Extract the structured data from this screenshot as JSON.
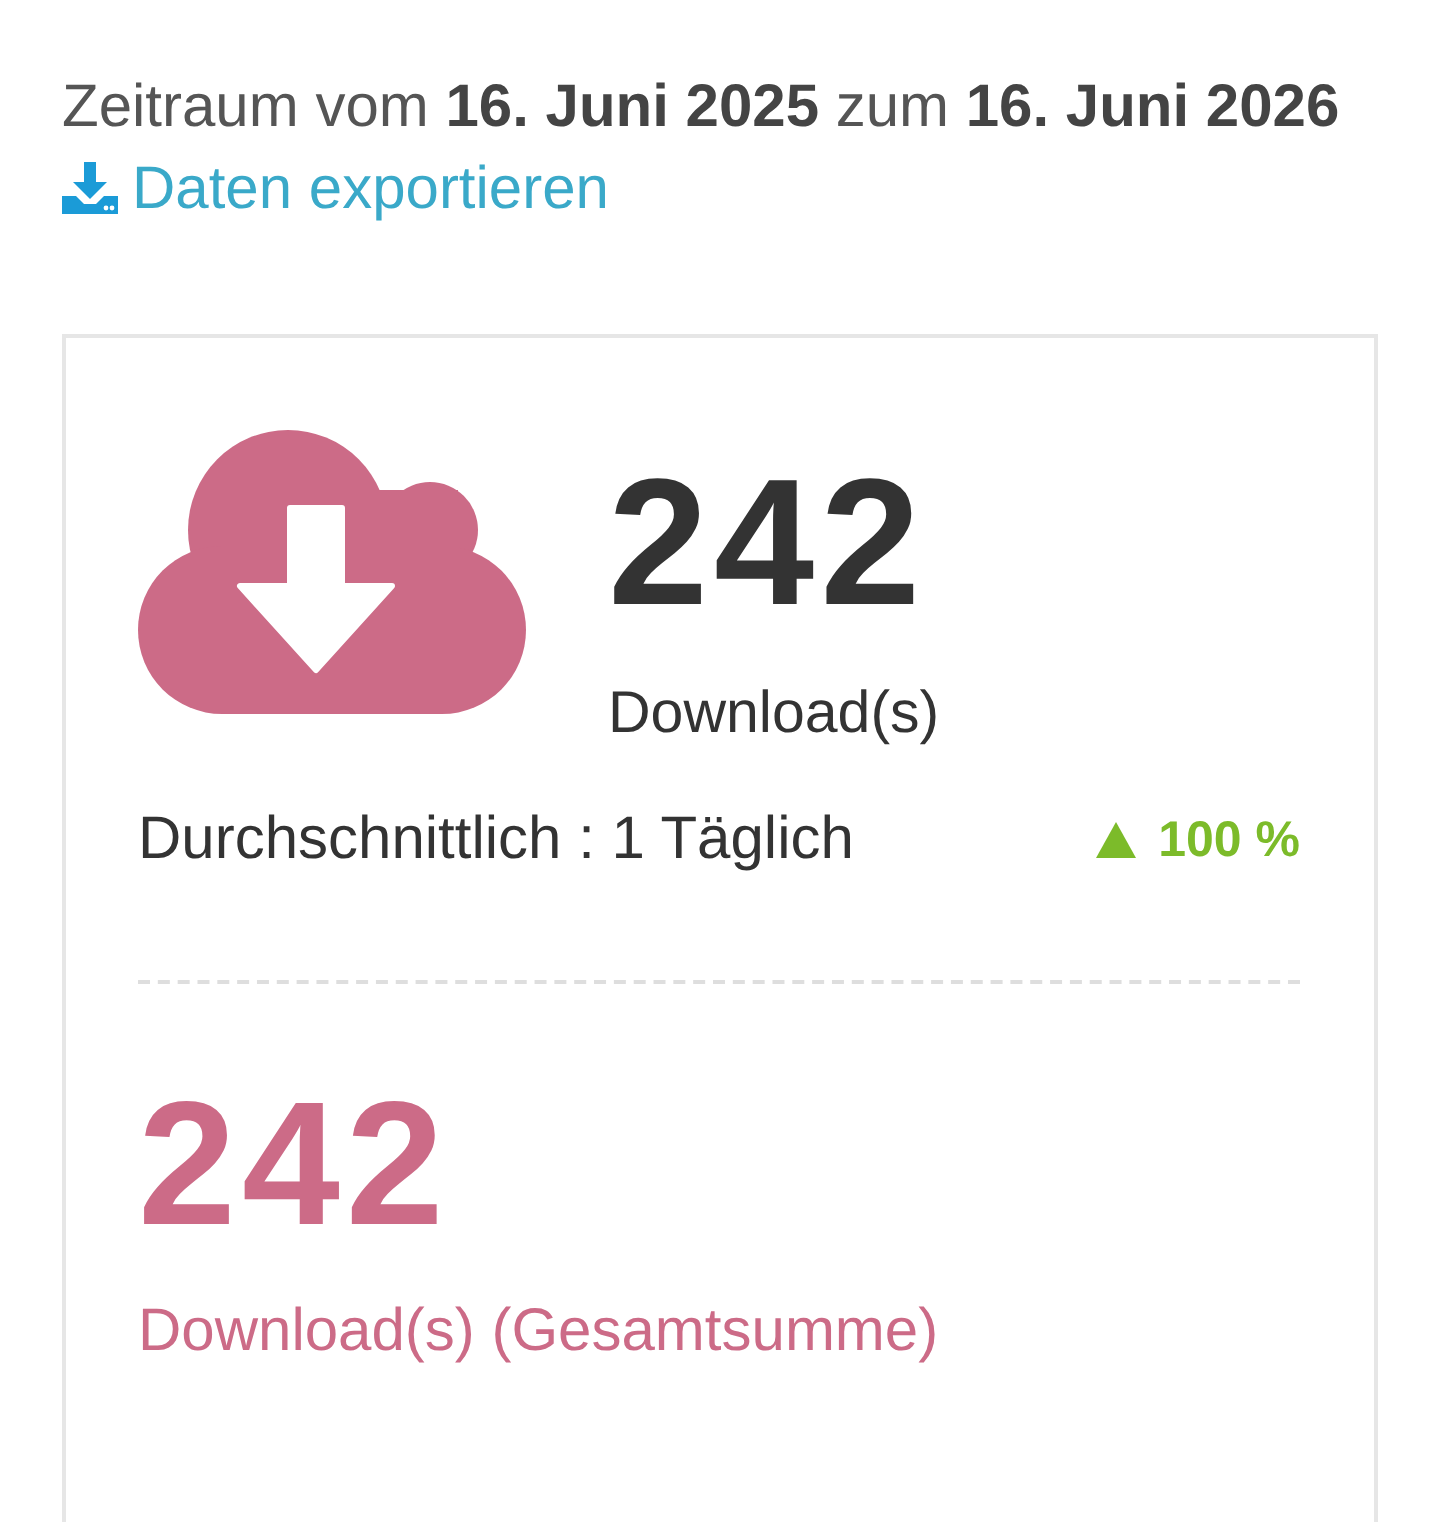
{
  "period": {
    "text": "Zeitraum vom **16. Juni 2025** zum **16. Juni 2026**"
  },
  "export_link": {
    "label": "Daten exportieren"
  },
  "stats_card": {
    "count": "242",
    "count_label": "Download(s)",
    "average": "Durchschnittlich : 1 Täglich",
    "trend": {
      "rising": true,
      "value": "100 %"
    },
    "total": "242",
    "total_label": "Download(s) (Gesamtsumme)"
  }
}
